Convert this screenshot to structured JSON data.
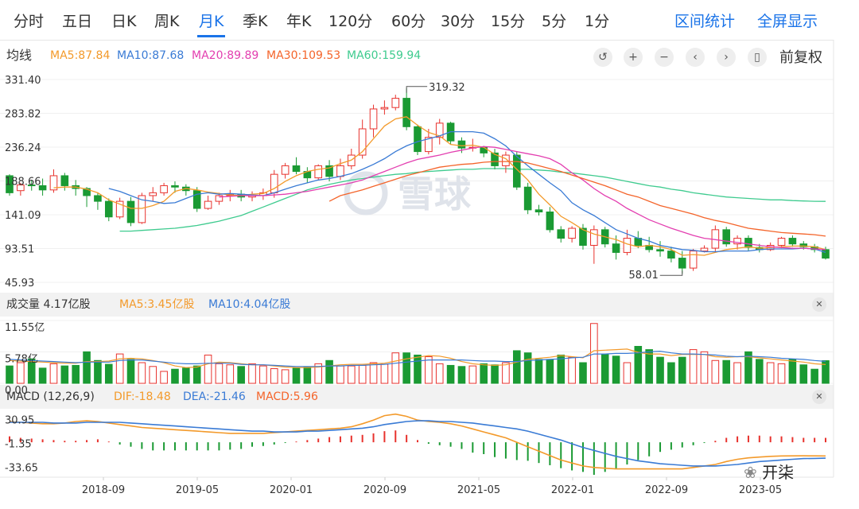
{
  "tabs": [
    "分时",
    "五日",
    "日K",
    "周K",
    "月K",
    "季K",
    "年K",
    "120分",
    "60分",
    "30分",
    "15分",
    "5分",
    "1分"
  ],
  "active_tab": "月K",
  "right_tabs": [
    "区间统计",
    "全屏显示"
  ],
  "ma_legend": {
    "title": "均线",
    "items": [
      {
        "label": "MA5:87.84",
        "color": "#f39a2b"
      },
      {
        "label": "MA10:87.68",
        "color": "#3a7bd5"
      },
      {
        "label": "MA20:89.89",
        "color": "#e33fb0"
      },
      {
        "label": "MA30:109.53",
        "color": "#f4642a"
      },
      {
        "label": "MA60:159.94",
        "color": "#3fcb8f"
      }
    ]
  },
  "controls": {
    "icons": [
      "reset-icon",
      "zoom-in-icon",
      "zoom-out-icon",
      "pan-left-icon",
      "pan-right-icon",
      "candle-style-icon"
    ],
    "adjust_label": "前复权"
  },
  "watermark": "雪球",
  "volume_legend": {
    "title": "成交量 4.17亿股",
    "items": [
      {
        "label": "MA5:3.45亿股",
        "color": "#f39a2b"
      },
      {
        "label": "MA10:4.04亿股",
        "color": "#3a7bd5"
      }
    ]
  },
  "macd_legend": {
    "title": "MACD (12,26,9)",
    "items": [
      {
        "label": "DIF:-18.48",
        "color": "#f39a2b"
      },
      {
        "label": "DEA:-21.46",
        "color": "#3a7bd5"
      },
      {
        "label": "MACD:5.96",
        "color": "#f4642a"
      }
    ]
  },
  "footer_brand": "开柒",
  "chart_data": {
    "type": "candlestick",
    "price_ticks": [
      "331.40",
      "283.82",
      "236.24",
      "188.66",
      "141.09",
      "93.51",
      "45.93"
    ],
    "price_range": [
      45.93,
      331.4
    ],
    "x_ticks": [
      "2018-09",
      "2019-05",
      "2020-01",
      "2020-09",
      "2021-05",
      "2022-01",
      "2022-09",
      "2023-05"
    ],
    "annotations": {
      "max_label": "319.32",
      "min_label": "58.01"
    },
    "candles": [
      [
        196,
        172,
        198,
        168
      ],
      [
        175,
        183,
        186,
        168
      ],
      [
        183,
        182,
        190,
        175
      ],
      [
        182,
        176,
        192,
        168
      ],
      [
        176,
        196,
        205,
        172
      ],
      [
        196,
        182,
        200,
        175
      ],
      [
        182,
        178,
        190,
        168
      ],
      [
        178,
        168,
        180,
        152
      ],
      [
        168,
        160,
        172,
        148
      ],
      [
        160,
        138,
        164,
        132
      ],
      [
        138,
        160,
        165,
        135
      ],
      [
        160,
        130,
        166,
        125
      ],
      [
        130,
        168,
        172,
        128
      ],
      [
        168,
        172,
        180,
        160
      ],
      [
        172,
        182,
        186,
        168
      ],
      [
        182,
        180,
        188,
        172
      ],
      [
        180,
        175,
        184,
        168
      ],
      [
        175,
        150,
        180,
        145
      ],
      [
        150,
        160,
        168,
        148
      ],
      [
        160,
        168,
        172,
        155
      ],
      [
        168,
        170,
        176,
        160
      ],
      [
        170,
        166,
        176,
        160
      ],
      [
        166,
        168,
        174,
        160
      ],
      [
        168,
        172,
        178,
        162
      ],
      [
        172,
        198,
        204,
        165
      ],
      [
        198,
        210,
        214,
        192
      ],
      [
        210,
        202,
        222,
        198
      ],
      [
        202,
        193,
        208,
        186
      ],
      [
        193,
        210,
        212,
        190
      ],
      [
        210,
        195,
        218,
        188
      ],
      [
        195,
        210,
        220,
        190
      ],
      [
        210,
        225,
        234,
        205
      ],
      [
        225,
        262,
        275,
        220
      ],
      [
        262,
        290,
        296,
        250
      ],
      [
        290,
        292,
        302,
        282
      ],
      [
        292,
        305,
        310,
        288
      ],
      [
        305,
        265,
        319.32,
        260
      ],
      [
        265,
        230,
        268,
        225
      ],
      [
        230,
        250,
        262,
        226
      ],
      [
        250,
        270,
        276,
        240
      ],
      [
        270,
        245,
        272,
        240
      ],
      [
        245,
        235,
        250,
        228
      ],
      [
        235,
        236,
        248,
        230
      ],
      [
        236,
        228,
        238,
        222
      ],
      [
        228,
        210,
        234,
        205
      ],
      [
        210,
        225,
        230,
        200
      ],
      [
        225,
        180,
        230,
        176
      ],
      [
        180,
        148,
        186,
        142
      ],
      [
        148,
        145,
        155,
        140
      ],
      [
        145,
        120,
        152,
        116
      ],
      [
        120,
        108,
        125,
        102
      ],
      [
        108,
        122,
        125,
        102
      ],
      [
        122,
        98,
        128,
        92
      ],
      [
        98,
        120,
        126,
        72
      ],
      [
        120,
        100,
        124,
        95
      ],
      [
        100,
        88,
        112,
        78
      ],
      [
        88,
        108,
        120,
        84
      ],
      [
        108,
        98,
        118,
        94
      ],
      [
        98,
        92,
        110,
        88
      ],
      [
        92,
        90,
        104,
        82
      ],
      [
        90,
        80,
        96,
        74
      ],
      [
        80,
        66,
        90,
        58.01
      ],
      [
        66,
        90,
        93,
        62
      ],
      [
        90,
        94,
        98,
        88
      ],
      [
        94,
        120,
        126,
        88
      ],
      [
        120,
        100,
        124,
        96
      ],
      [
        100,
        108,
        112,
        92
      ],
      [
        108,
        95,
        112,
        90
      ],
      [
        95,
        92,
        100,
        88
      ],
      [
        92,
        98,
        102,
        90
      ],
      [
        98,
        108,
        110,
        94
      ],
      [
        108,
        100,
        112,
        96
      ],
      [
        100,
        96,
        104,
        92
      ],
      [
        96,
        92,
        100,
        88
      ],
      [
        92,
        80,
        96,
        78
      ]
    ],
    "ma_series": {
      "MA5": [
        null,
        null,
        null,
        null,
        179,
        180,
        180,
        177,
        172,
        162,
        156,
        150,
        150,
        154,
        160,
        174,
        178,
        176,
        173,
        171,
        169,
        168,
        170,
        171,
        178,
        188,
        196,
        202,
        205,
        207,
        213,
        218,
        230,
        248,
        266,
        276,
        279,
        267,
        257,
        252,
        240,
        238,
        239,
        236,
        226,
        220,
        205,
        190,
        170,
        155,
        139,
        130,
        120,
        114,
        110,
        106,
        100,
        96,
        98,
        96,
        92,
        84,
        85,
        84,
        88,
        92,
        94,
        96,
        94,
        95,
        96,
        97,
        97,
        96,
        92
      ],
      "MA10": [
        null,
        null,
        null,
        null,
        null,
        null,
        null,
        null,
        null,
        178,
        174,
        168,
        162,
        160,
        157,
        158,
        164,
        170,
        172,
        170,
        171,
        170,
        169,
        168,
        172,
        177,
        182,
        186,
        190,
        192,
        195,
        199,
        205,
        212,
        220,
        230,
        238,
        244,
        248,
        252,
        258,
        258,
        258,
        256,
        248,
        238,
        223,
        210,
        198,
        186,
        175,
        158,
        148,
        140,
        130,
        120,
        114,
        108,
        104,
        98,
        95,
        92,
        91,
        89,
        89,
        90,
        90,
        90,
        92,
        93,
        93,
        93,
        94,
        93,
        88
      ],
      "MA20": [
        null,
        null,
        null,
        null,
        null,
        null,
        null,
        null,
        null,
        null,
        null,
        null,
        null,
        null,
        null,
        null,
        null,
        null,
        null,
        166,
        167,
        168,
        168,
        168,
        169,
        170,
        172,
        174,
        177,
        180,
        183,
        186,
        190,
        196,
        202,
        208,
        214,
        219,
        222,
        225,
        229,
        232,
        235,
        237,
        236,
        233,
        230,
        227,
        224,
        220,
        212,
        200,
        190,
        178,
        168,
        160,
        150,
        142,
        134,
        128,
        122,
        117,
        112,
        108,
        106,
        104,
        102,
        100,
        98,
        96,
        95,
        94,
        94,
        93,
        92
      ],
      "MA30": [
        null,
        null,
        null,
        null,
        null,
        null,
        null,
        null,
        null,
        null,
        null,
        null,
        null,
        null,
        null,
        null,
        null,
        null,
        null,
        null,
        null,
        null,
        null,
        null,
        null,
        null,
        null,
        null,
        null,
        160,
        168,
        172,
        176,
        181,
        186,
        191,
        196,
        200,
        204,
        208,
        210,
        212,
        213,
        215,
        216,
        216,
        216,
        214,
        210,
        206,
        202,
        197,
        192,
        187,
        182,
        176,
        170,
        166,
        160,
        154,
        150,
        146,
        142,
        137,
        133,
        130,
        126,
        122,
        120,
        118,
        116,
        115,
        114,
        113,
        111
      ],
      "MA60": [
        null,
        null,
        null,
        null,
        null,
        null,
        null,
        null,
        null,
        null,
        null,
        null,
        null,
        null,
        null,
        null,
        null,
        null,
        null,
        null,
        null,
        null,
        null,
        null,
        null,
        null,
        null,
        null,
        null,
        null,
        null,
        null,
        null,
        null,
        null,
        null,
        null,
        null,
        null,
        null,
        null,
        null,
        null,
        null,
        null,
        null,
        null,
        null,
        null,
        null,
        null,
        null,
        null,
        null,
        null,
        null,
        null,
        null,
        null,
        null,
        null,
        null,
        null,
        null,
        null,
        null,
        null,
        null,
        null,
        null,
        null,
        null,
        null,
        null,
        null
      ]
    },
    "ma60_values": [
      118,
      118,
      119,
      120,
      121,
      122,
      124,
      126,
      129,
      132,
      136,
      140,
      146,
      152,
      158,
      164,
      170,
      176,
      180,
      184,
      187,
      190,
      192,
      194,
      196,
      198,
      199,
      201,
      202,
      203,
      204,
      205,
      205,
      206,
      206,
      206,
      205,
      205,
      204,
      203,
      201,
      200,
      198,
      196,
      194,
      191,
      188,
      185,
      182,
      180,
      177,
      175,
      172,
      170,
      168,
      166,
      165,
      164,
      163,
      162,
      162,
      161,
      160.5,
      160,
      159.94
    ],
    "volume_ticks": [
      "11.55亿",
      "5.78亿",
      "0.00"
    ],
    "volume_max": 11.55,
    "volumes": [
      3.2,
      3.8,
      4.5,
      2.8,
      3.6,
      3.2,
      3.3,
      5.8,
      4.2,
      3.5,
      5.4,
      4.4,
      3.8,
      3.1,
      2.2,
      2.6,
      2.8,
      3.2,
      5.2,
      3.6,
      3.4,
      3.1,
      3.6,
      3.2,
      2.7,
      2.5,
      2.8,
      3.0,
      3.6,
      4.2,
      3.2,
      3.2,
      3.3,
      3.8,
      3.5,
      5.6,
      5.6,
      5.2,
      4.9,
      3.6,
      3.3,
      3.1,
      3.2,
      3.6,
      3.4,
      3.8,
      6.0,
      5.6,
      4.4,
      4.4,
      5.2,
      4.8,
      3.8,
      11.0,
      5.4,
      5.0,
      3.8,
      6.8,
      6.2,
      4.8,
      3.8,
      4.8,
      6.2,
      5.8,
      4.2,
      4.2,
      3.8,
      5.8,
      4.4,
      3.8,
      3.6,
      4.4,
      3.4,
      2.6,
      4.17
    ],
    "volume_ma5": [
      4.2,
      4.1,
      4.0,
      3.9,
      3.8,
      3.7,
      3.7,
      4.0,
      4.0,
      4.1,
      4.5,
      4.6,
      4.5,
      4.2,
      3.8,
      3.2,
      2.9,
      3.0,
      3.6,
      3.9,
      3.8,
      3.6,
      3.4,
      3.4,
      3.2,
      3.0,
      2.9,
      2.9,
      3.0,
      3.2,
      3.4,
      3.5,
      3.5,
      3.6,
      3.7,
      4.1,
      4.5,
      4.8,
      5.1,
      5.0,
      4.6,
      4.0,
      3.6,
      3.4,
      3.3,
      3.4,
      3.9,
      4.4,
      4.6,
      4.8,
      5.1,
      4.9,
      4.7,
      6.0,
      6.1,
      6.2,
      6.3,
      5.7,
      5.4,
      5.4,
      5.1,
      5.3,
      5.3,
      5.3,
      4.9,
      4.8,
      4.9,
      4.9,
      4.7,
      4.5,
      4.3,
      4.1,
      3.9,
      3.6,
      3.45
    ],
    "volume_ma10": [
      4.4,
      4.3,
      4.2,
      4.1,
      4.0,
      3.9,
      3.8,
      3.9,
      3.9,
      3.9,
      4.2,
      4.3,
      4.3,
      4.1,
      3.9,
      3.7,
      3.6,
      3.6,
      3.7,
      3.7,
      3.7,
      3.5,
      3.4,
      3.4,
      3.3,
      3.2,
      3.1,
      3.1,
      3.1,
      3.2,
      3.2,
      3.3,
      3.3,
      3.4,
      3.5,
      3.7,
      3.9,
      4.1,
      4.3,
      4.3,
      4.3,
      4.3,
      4.2,
      4.1,
      4.1,
      4.0,
      4.0,
      4.2,
      4.3,
      4.4,
      4.5,
      4.7,
      4.8,
      5.4,
      5.4,
      5.5,
      5.5,
      5.6,
      5.8,
      5.9,
      5.6,
      5.4,
      5.4,
      5.3,
      5.2,
      5.0,
      4.9,
      5.0,
      4.9,
      4.8,
      4.6,
      4.5,
      4.4,
      4.2,
      4.04
    ],
    "macd_ticks": [
      "30.95",
      "-1.35",
      "-33.65"
    ],
    "macd_range": [
      -45,
      42
    ],
    "dif": [
      28,
      27,
      26,
      25,
      25,
      26,
      28,
      29,
      28,
      26,
      24,
      22,
      20,
      19,
      18,
      17,
      16,
      15,
      14,
      13,
      12,
      12,
      12,
      12,
      13,
      14,
      15,
      16,
      17,
      18,
      19,
      21,
      25,
      30,
      36,
      38,
      35,
      30,
      28,
      27,
      25,
      22,
      18,
      14,
      10,
      6,
      0,
      -6,
      -12,
      -18,
      -24,
      -28,
      -32,
      -34,
      -35,
      -36,
      -36,
      -36,
      -36,
      -36,
      -36,
      -36,
      -34,
      -32,
      -30,
      -26,
      -23,
      -21,
      -20,
      -19,
      -18.5,
      -18.4,
      -18.3,
      -18.4,
      -18.48
    ],
    "dea": [
      27,
      27,
      27,
      27,
      26,
      26,
      26,
      27,
      27,
      27,
      27,
      26,
      25,
      24,
      23,
      22,
      21,
      20,
      19,
      18,
      17,
      16,
      15,
      15,
      14,
      14,
      14,
      15,
      15,
      16,
      17,
      18,
      19,
      21,
      24,
      26,
      28,
      29,
      29,
      28,
      28,
      27,
      26,
      24,
      22,
      20,
      18,
      15,
      11,
      7,
      3,
      -2,
      -7,
      -11,
      -15,
      -19,
      -22,
      -25,
      -27,
      -29,
      -30,
      -31,
      -32,
      -32,
      -32,
      -31,
      -30,
      -28,
      -26,
      -25,
      -24,
      -23,
      -22,
      -21.8,
      -21.46
    ],
    "macd": [
      8,
      6,
      5,
      4,
      3,
      2,
      2,
      3,
      4,
      1,
      -3,
      -6,
      -9,
      -11,
      -11,
      -11,
      -11,
      -11,
      -11,
      -11,
      -10,
      -9,
      -6,
      -5,
      -3,
      -1,
      1,
      3,
      5,
      7,
      8,
      9,
      10,
      12,
      15,
      16,
      10,
      3,
      -2,
      -4,
      -6,
      -9,
      -14,
      -16,
      -20,
      -22,
      -24,
      -25,
      -28,
      -31,
      -35,
      -38,
      -40,
      -44,
      -40,
      -36,
      -30,
      -24,
      -19,
      -13,
      -10,
      -7,
      -4,
      -1,
      2,
      6,
      8,
      9,
      9,
      8,
      8,
      7,
      6,
      6,
      5.96
    ]
  }
}
